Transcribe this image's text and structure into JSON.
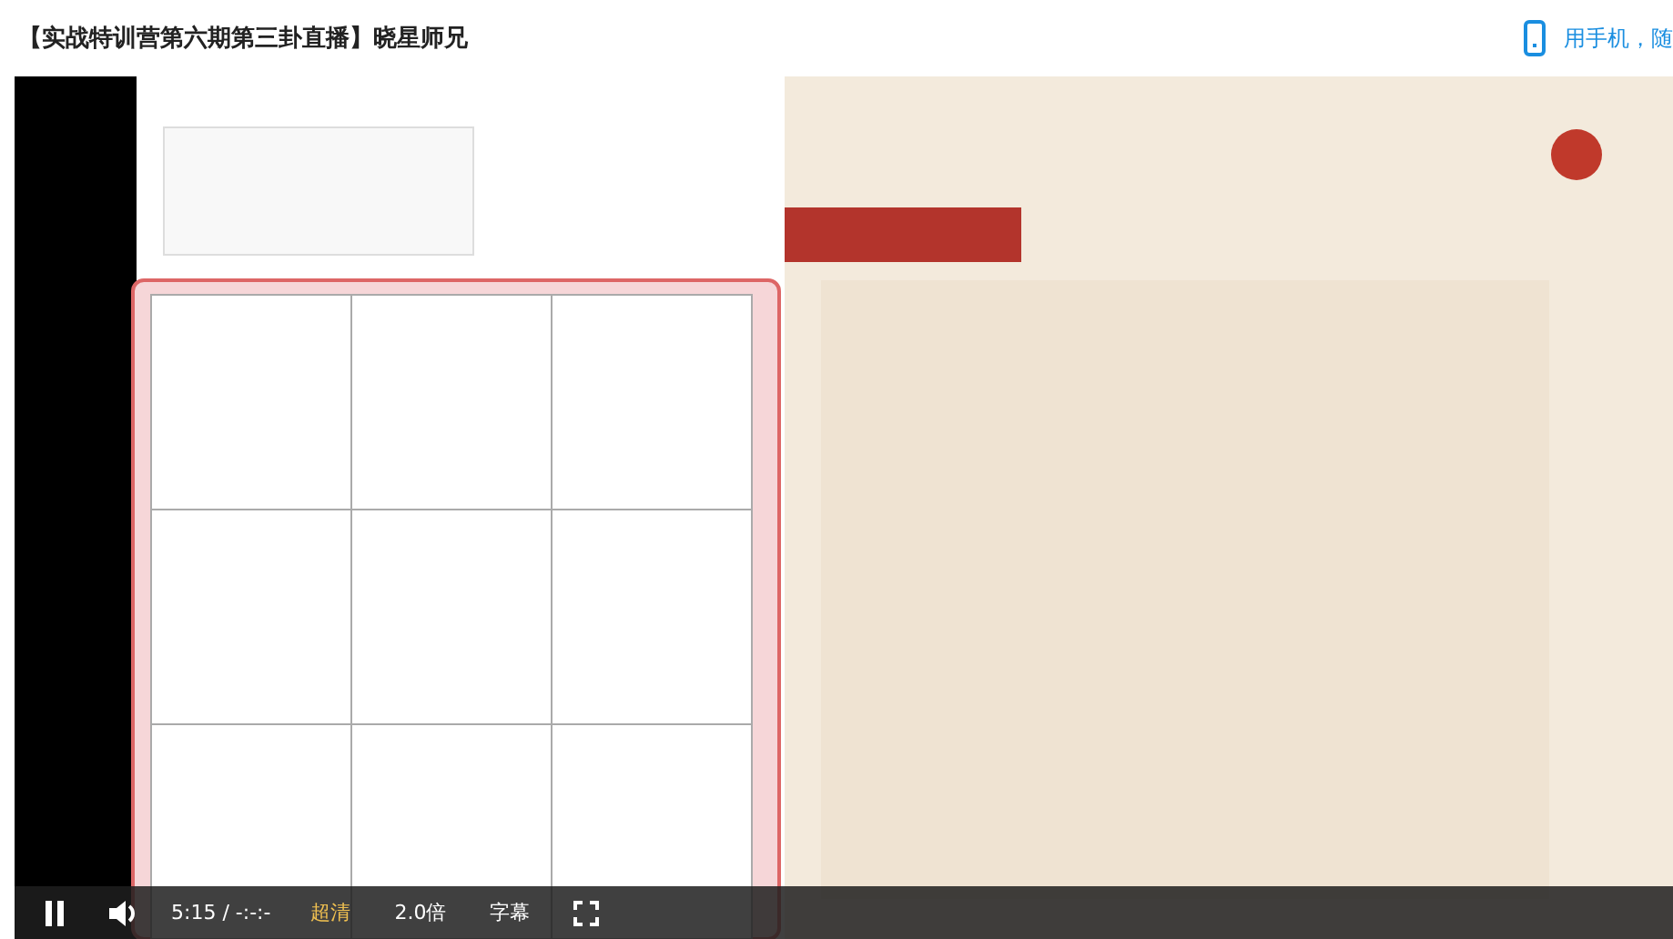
{
  "page_title": "【实战特训营第六期第三卦直播】晓星师兄",
  "mobile_link": "用手机，随",
  "video": {
    "playing": true,
    "controls": {
      "time": "5:15 / -:-:-",
      "options": [
        {
          "label": "超清",
          "selected": true
        },
        {
          "label": "2.0倍",
          "selected": false
        },
        {
          "label": "字幕",
          "selected": false
        }
      ]
    }
  }
}
